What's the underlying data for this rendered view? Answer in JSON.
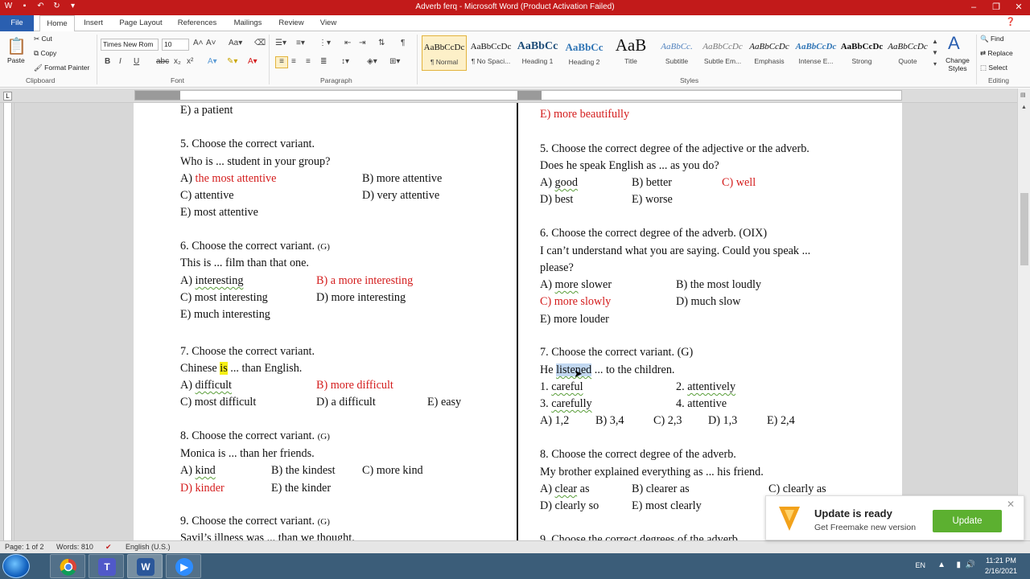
{
  "window": {
    "title": "Adverb ferq  -  Microsoft Word (Product Activation Failed)"
  },
  "tabs": [
    "File",
    "Home",
    "Insert",
    "Page Layout",
    "References",
    "Mailings",
    "Review",
    "View"
  ],
  "ribbon": {
    "clipboard": {
      "paste": "Paste",
      "cut": "Cut",
      "copy": "Copy",
      "format_painter": "Format Painter",
      "label": "Clipboard"
    },
    "font": {
      "name": "Times New Rom",
      "size": "10",
      "label": "Font"
    },
    "paragraph": {
      "label": "Paragraph"
    },
    "styles": {
      "label": "Styles",
      "items": [
        {
          "preview": "AaBbCcDc",
          "name": "¶ Normal"
        },
        {
          "preview": "AaBbCcDc",
          "name": "¶ No Spaci..."
        },
        {
          "preview": "AaBbCc",
          "name": "Heading 1"
        },
        {
          "preview": "AaBbCc",
          "name": "Heading 2"
        },
        {
          "preview": "AaB",
          "name": "Title"
        },
        {
          "preview": "AaBbCc.",
          "name": "Subtitle"
        },
        {
          "preview": "AaBbCcDc",
          "name": "Subtle Em..."
        },
        {
          "preview": "AaBbCcDc",
          "name": "Emphasis"
        },
        {
          "preview": "AaBbCcDc",
          "name": "Intense E..."
        },
        {
          "preview": "AaBbCcDc",
          "name": "Strong"
        },
        {
          "preview": "AaBbCcDc",
          "name": "Quote"
        }
      ],
      "change": "Change Styles"
    },
    "editing": {
      "find": "Find",
      "replace": "Replace",
      "select": "Select",
      "label": "Editing"
    }
  },
  "doc_left": {
    "l1": "E) a patient",
    "q5": "5. Choose the correct variant.",
    "q5_q": "Who is ... student in your group?",
    "q5_a_p": "A) ",
    "q5_a": "the most attentive",
    "q5_b": "B) more attentive",
    "q5_c": "C) attentive",
    "q5_d": "D) very attentive",
    "q5_e": "E) most attentive",
    "q6": "6. Choose the correct variant.",
    "q6_tag": "(G)",
    "q6_q": "This is ... film than that one.",
    "q6_a_p": "A) ",
    "q6_a": "interesting",
    "q6_b": "B) a more interesting",
    "q6_c": "C) most interesting",
    "q6_d": "D) more interesting",
    "q6_e": "E) much interesting",
    "q7": "7. Choose the correct variant.",
    "q7_q1": "Chinese ",
    "q7_q_hl": "is",
    "q7_q2": " ... than English.",
    "q7_a_p": "A) ",
    "q7_a": "difficult",
    "q7_b": "B) more difficult",
    "q7_c": "C) most difficult",
    "q7_d": "D) a difficult",
    "q7_e": "E) easy",
    "q8": "8. Choose the correct variant.",
    "q8_tag": "(G)",
    "q8_q": "Monica is ... than her friends.",
    "q8_a_p": "A) ",
    "q8_a": "kind",
    "q8_b": "B) the kindest",
    "q8_c": "C) more kind",
    "q8_d": "D) kinder",
    "q8_e": "E) the kinder",
    "q9": "9. Choose the correct variant.",
    "q9_tag": "(G)",
    "q9_q": "Savil’s illness was ... than we thought."
  },
  "doc_right": {
    "l1": "E) more beautifully",
    "q5": "5. Choose the correct degree of the adjective or the adverb.",
    "q5_q": "Does he speak English as ... as you do?",
    "q5_a_p": "A) ",
    "q5_a": "good",
    "q5_b": "B) better",
    "q5_c": "C) well",
    "q5_d": "D) best",
    "q5_e": "E) worse",
    "q6": "6. Choose the correct degree of the adverb.  (OIX)",
    "q6_q1": "I can’t understand what you are saying. Could you speak ...",
    "q6_q2": "please?",
    "q6_a_p": "A) ",
    "q6_a": "more",
    "q6_a2": " slower",
    "q6_b": "B) the most loudly",
    "q6_c": "C) more slowly",
    "q6_d": "D) much slow",
    "q6_e": "E) more louder",
    "q7": "7. Choose the correct variant. (G)",
    "q7_q1": "He ",
    "q7_q_sel": "listened",
    "q7_q2": " ... to the children.",
    "q7_o1_p": "1. ",
    "q7_o1": "careful",
    "q7_o2_p": "2. ",
    "q7_o2": "attentively",
    "q7_o3_p": "3. ",
    "q7_o3": "carefully",
    "q7_o4": "4. attentive",
    "q7_a": "A) 1,2",
    "q7_b": "B) 3,4",
    "q7_c": "C) 2,3",
    "q7_d": "D) 1,3",
    "q7_e": "E) 2,4",
    "q8": "8. Choose the correct degree of the adverb.",
    "q8_q": "My brother explained everything as ... his friend.",
    "q8_a_p": "A) ",
    "q8_a": "clear",
    "q8_a2": " as",
    "q8_b": "B) clearer as",
    "q8_c": "C) clearly as",
    "q8_d": "D) clearly so",
    "q8_e": "E) most clearly",
    "q9": "9. Choose the correct degrees of the adverb."
  },
  "status": {
    "page": "Page: 1 of 2",
    "words": "Words: 810",
    "language": "English (U.S.)"
  },
  "toast": {
    "title": "Update is ready",
    "subtitle": "Get Freemake new version",
    "button": "Update"
  },
  "tray": {
    "lang": "EN",
    "time": "11:21 PM",
    "date": "2/16/2021"
  },
  "colors": {
    "title_bar": "#c21a1a",
    "answer_red": "#d41c1c",
    "taskbar": "#3b5d79",
    "update_green": "#5cb030"
  }
}
